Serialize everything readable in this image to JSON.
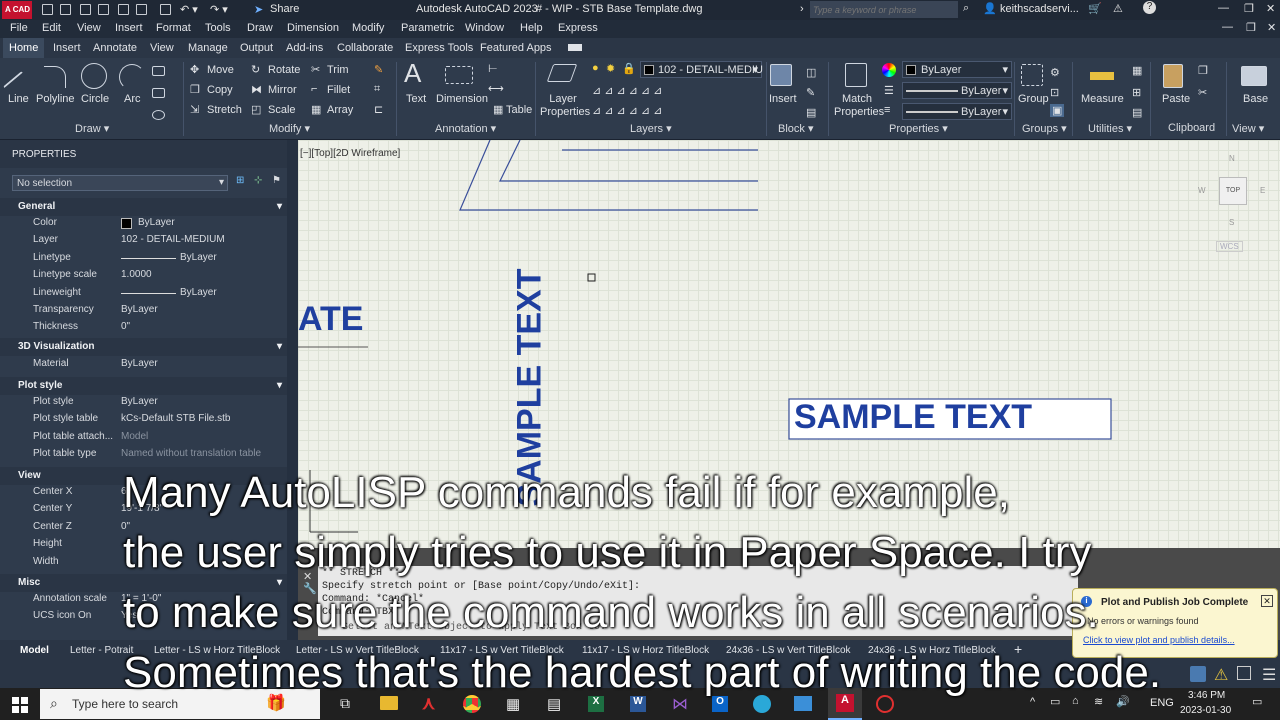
{
  "app": {
    "title": "Autodesk AutoCAD 2023",
    "file_tab": "# - WIP - STB Base Template.dwg",
    "search_placeholder": "Type a keyword or phrase",
    "user": "keithscadservi...",
    "share_label": "Share",
    "logo_text": "A CAD"
  },
  "menu": [
    "File",
    "Edit",
    "View",
    "Insert",
    "Format",
    "Tools",
    "Draw",
    "Dimension",
    "Modify",
    "Parametric",
    "Window",
    "Help",
    "Express"
  ],
  "ribbon_tabs": [
    "Home",
    "Insert",
    "Annotate",
    "View",
    "Manage",
    "Output",
    "Add-ins",
    "Collaborate",
    "Express Tools",
    "Featured Apps"
  ],
  "ribbon": {
    "draw_tools": [
      "Line",
      "Polyline",
      "Circle",
      "Arc"
    ],
    "modify_tools": [
      "Move",
      "Rotate",
      "Trim",
      "Copy",
      "Mirror",
      "Fillet",
      "Stretch",
      "Scale",
      "Array"
    ],
    "annotation_tools": [
      "Text",
      "Dimension",
      "Table"
    ],
    "layer_props": "Layer Properties",
    "layer_current": "102 - DETAIL-MEDIU",
    "block_insert": "Insert",
    "match_props": "Match Properties",
    "prop_color": "ByLayer",
    "prop_linetype": "ByLayer",
    "prop_lineweight": "ByLayer",
    "group": "Group",
    "measure": "Measure",
    "paste": "Paste",
    "base": "Base",
    "panels": [
      "Draw",
      "Modify",
      "Annotation",
      "Layers",
      "Block",
      "Properties",
      "Groups",
      "Utilities",
      "Clipboard",
      "View"
    ]
  },
  "properties": {
    "title": "PROPERTIES",
    "selection": "No selection",
    "sections": {
      "general": "General",
      "viz3d": "3D Visualization",
      "plot": "Plot style",
      "view": "View",
      "misc": "Misc"
    },
    "general_rows": [
      {
        "k": "Color",
        "v": "ByLayer"
      },
      {
        "k": "Layer",
        "v": "102 - DETAIL-MEDIUM"
      },
      {
        "k": "Linetype",
        "v": "ByLayer"
      },
      {
        "k": "Linetype scale",
        "v": "1.0000"
      },
      {
        "k": "Lineweight",
        "v": "ByLayer"
      },
      {
        "k": "Transparency",
        "v": "ByLayer"
      },
      {
        "k": "Thickness",
        "v": "0\""
      }
    ],
    "viz_rows": [
      {
        "k": "Material",
        "v": "ByLayer"
      }
    ],
    "plot_rows": [
      {
        "k": "Plot style",
        "v": "ByLayer"
      },
      {
        "k": "Plot style table",
        "v": "kCs-Default STB File.stb"
      },
      {
        "k": "Plot table attach...",
        "v": "Model"
      },
      {
        "k": "Plot table type",
        "v": "Named without translation table"
      }
    ],
    "view_rows": [
      {
        "k": "Center X",
        "v": "6"
      },
      {
        "k": "Center Y",
        "v": "19'-1 7/8\""
      },
      {
        "k": "Center Z",
        "v": "0\""
      },
      {
        "k": "Height",
        "v": ""
      },
      {
        "k": "Width",
        "v": ""
      }
    ],
    "misc_rows": [
      {
        "k": "Annotation scale",
        "v": "1\" = 1'-0\""
      },
      {
        "k": "UCS icon On",
        "v": "Yes"
      }
    ]
  },
  "canvas": {
    "viewport_label": "[−][Top][2D Wireframe]",
    "text_partial": "ATE",
    "text_vertical": "SAMPLE TEXT",
    "text_box": "SAMPLE TEXT",
    "viewcube_top": "TOP",
    "viewcube_n": "N",
    "viewcube_w": "W",
    "viewcube_e": "E",
    "viewcube_s": "S",
    "wcs": "WCS"
  },
  "command": {
    "lines": [
      "** STRETCH **",
      "Specify stretch point or [Base point/Copy/Undo/eXit]:",
      "Command: *Cancel*",
      "Command: TBX",
      "Select an MText object to apply Text Box to:"
    ]
  },
  "layout_tabs": [
    "Model",
    "Letter - Potrait",
    "Letter - LS w Horz TitleBlock",
    "Letter - LS w Vert TitleBlock",
    "11x17 - LS w Vert TitleBlock",
    "11x17 - LS w Horz TitleBlock",
    "24x36 - LS w Vert TitleBlcok",
    "24x36 - LS w Horz TitleBlock"
  ],
  "notification": {
    "title": "Plot and Publish Job Complete",
    "body": "No errors or warnings found",
    "link": "Click to view plot and publish details..."
  },
  "taskbar": {
    "search_placeholder": "Type here to search",
    "lang": "ENG",
    "time": "3:46 PM",
    "date": "2023-01-30"
  },
  "subtitles": [
    "Many AutoLISP commands fail if for example,",
    "the user simply tries to use it in Paper Space. I try",
    "to make sure the command works in all scenarios.",
    "Sometimes that's the hardest part of writing the code."
  ],
  "colors": {
    "accent_blue": "#1f3f9f",
    "ui_dark": "#2f3b4c",
    "canvas_bg": "#eef0e8"
  }
}
